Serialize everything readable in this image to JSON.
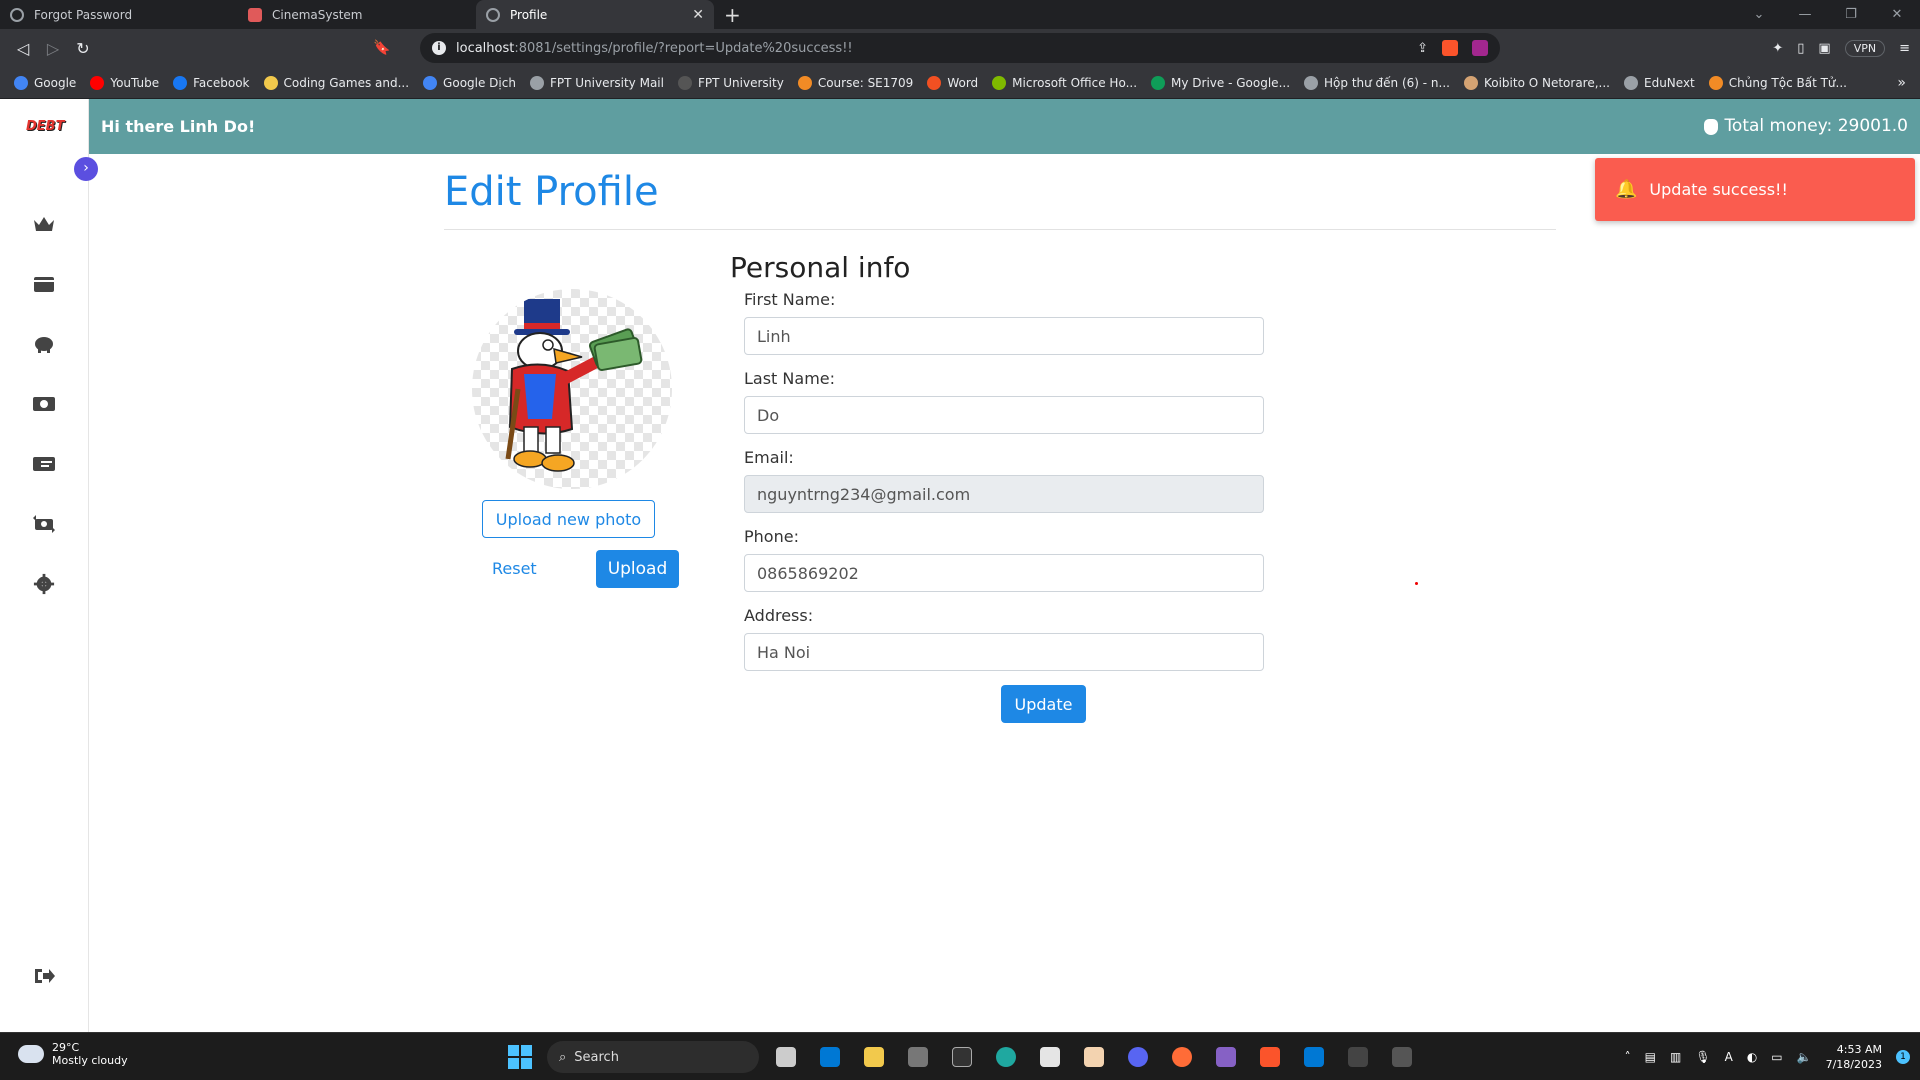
{
  "browser": {
    "tabs": [
      {
        "title": "Forgot Password",
        "active": false
      },
      {
        "title": "CinemaSystem",
        "active": false
      },
      {
        "title": "Profile",
        "active": true
      }
    ],
    "url_host": "localhost",
    "url_rest": ":8081/settings/profile/?report=Update%20success!!",
    "vpn_label": "VPN",
    "bookmarks": [
      {
        "label": "Google",
        "color": "#4285f4"
      },
      {
        "label": "YouTube",
        "color": "#ff0000"
      },
      {
        "label": "Facebook",
        "color": "#1877f2"
      },
      {
        "label": "Coding Games and...",
        "color": "#f2c94c"
      },
      {
        "label": "Google Dịch",
        "color": "#4285f4"
      },
      {
        "label": "FPT University Mail",
        "color": "#9aa0a6"
      },
      {
        "label": "FPT University",
        "color": "#555555"
      },
      {
        "label": "Course: SE1709",
        "color": "#f28b25"
      },
      {
        "label": "Word",
        "color": "#f25022"
      },
      {
        "label": "Microsoft Office Ho...",
        "color": "#7fba00"
      },
      {
        "label": "My Drive - Google...",
        "color": "#0f9d58"
      },
      {
        "label": "Hộp thư đến (6) - n...",
        "color": "#9aa0a6"
      },
      {
        "label": "Koibito O Netorare,...",
        "color": "#d4a373"
      },
      {
        "label": "EduNext",
        "color": "#9aa0a6"
      },
      {
        "label": "Chủng Tộc Bất Tử...",
        "color": "#f28b25"
      }
    ]
  },
  "app": {
    "logo_text": "DEBT",
    "greeting": "Hi there Linh Do!",
    "total_money": "Total money: 29001.0",
    "page_title": "Edit Profile",
    "section_title": "Personal info",
    "upload_new_photo_label": "Upload new photo",
    "reset_label": "Reset",
    "upload_label": "Upload",
    "fields": {
      "first_name": {
        "label": "First Name:",
        "value": "Linh"
      },
      "last_name": {
        "label": "Last Name:",
        "value": "Do"
      },
      "email": {
        "label": "Email:",
        "value": "nguyntrng234@gmail.com"
      },
      "phone": {
        "label": "Phone:",
        "value": "0865869202"
      },
      "address": {
        "label": "Address:",
        "value": "Ha Noi"
      }
    },
    "update_label": "Update",
    "toast_message": "Update success!!",
    "sidebar_icons": [
      "crown-icon",
      "wallet-icon",
      "piggy-bank-icon",
      "money-icon",
      "money-check-icon",
      "exchange-icon",
      "gear-icon",
      "logout-icon"
    ],
    "colors": {
      "topbar": "#5f9ea0",
      "primary": "#1e88e5",
      "toast": "#fa5c4f"
    }
  },
  "taskbar": {
    "temperature": "29°C",
    "weather": "Mostly cloudy",
    "search_label": "Search",
    "time": "4:53 AM",
    "date": "7/18/2023",
    "notification_count": "1"
  }
}
